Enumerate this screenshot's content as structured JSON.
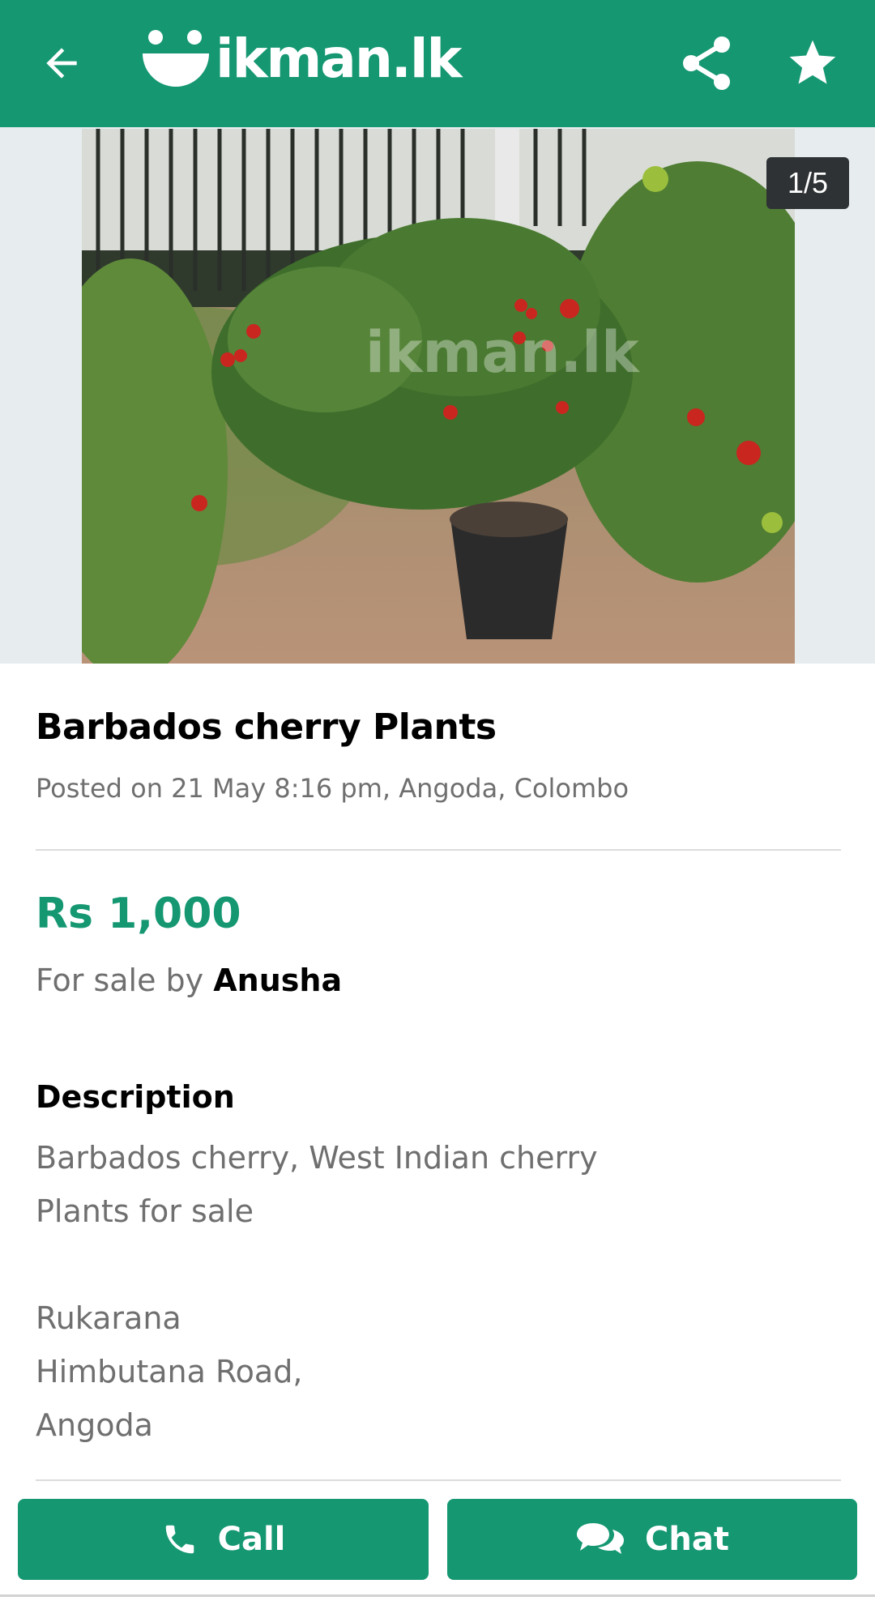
{
  "header": {
    "logo_text": "ikman.lk",
    "brand_color": "#159772",
    "icons": [
      "back-arrow-icon",
      "ikman-logo-icon",
      "share-icon",
      "star-icon"
    ]
  },
  "gallery": {
    "counter": "1/5",
    "watermark": "ikman.lk"
  },
  "ad": {
    "title": "Barbados cherry Plants",
    "posted": "Posted on 21 May 8:16 pm, Angoda, Colombo",
    "price": "Rs 1,000",
    "seller_prefix": "For sale by",
    "seller_name": "Anusha"
  },
  "description": {
    "heading": "Description",
    "lines": [
      "Barbados cherry, West Indian cherry",
      "Plants for sale",
      "",
      "Rukarana",
      "Himbutana Road,",
      "Angoda"
    ]
  },
  "actions": {
    "call_label": "Call",
    "chat_label": "Chat"
  }
}
